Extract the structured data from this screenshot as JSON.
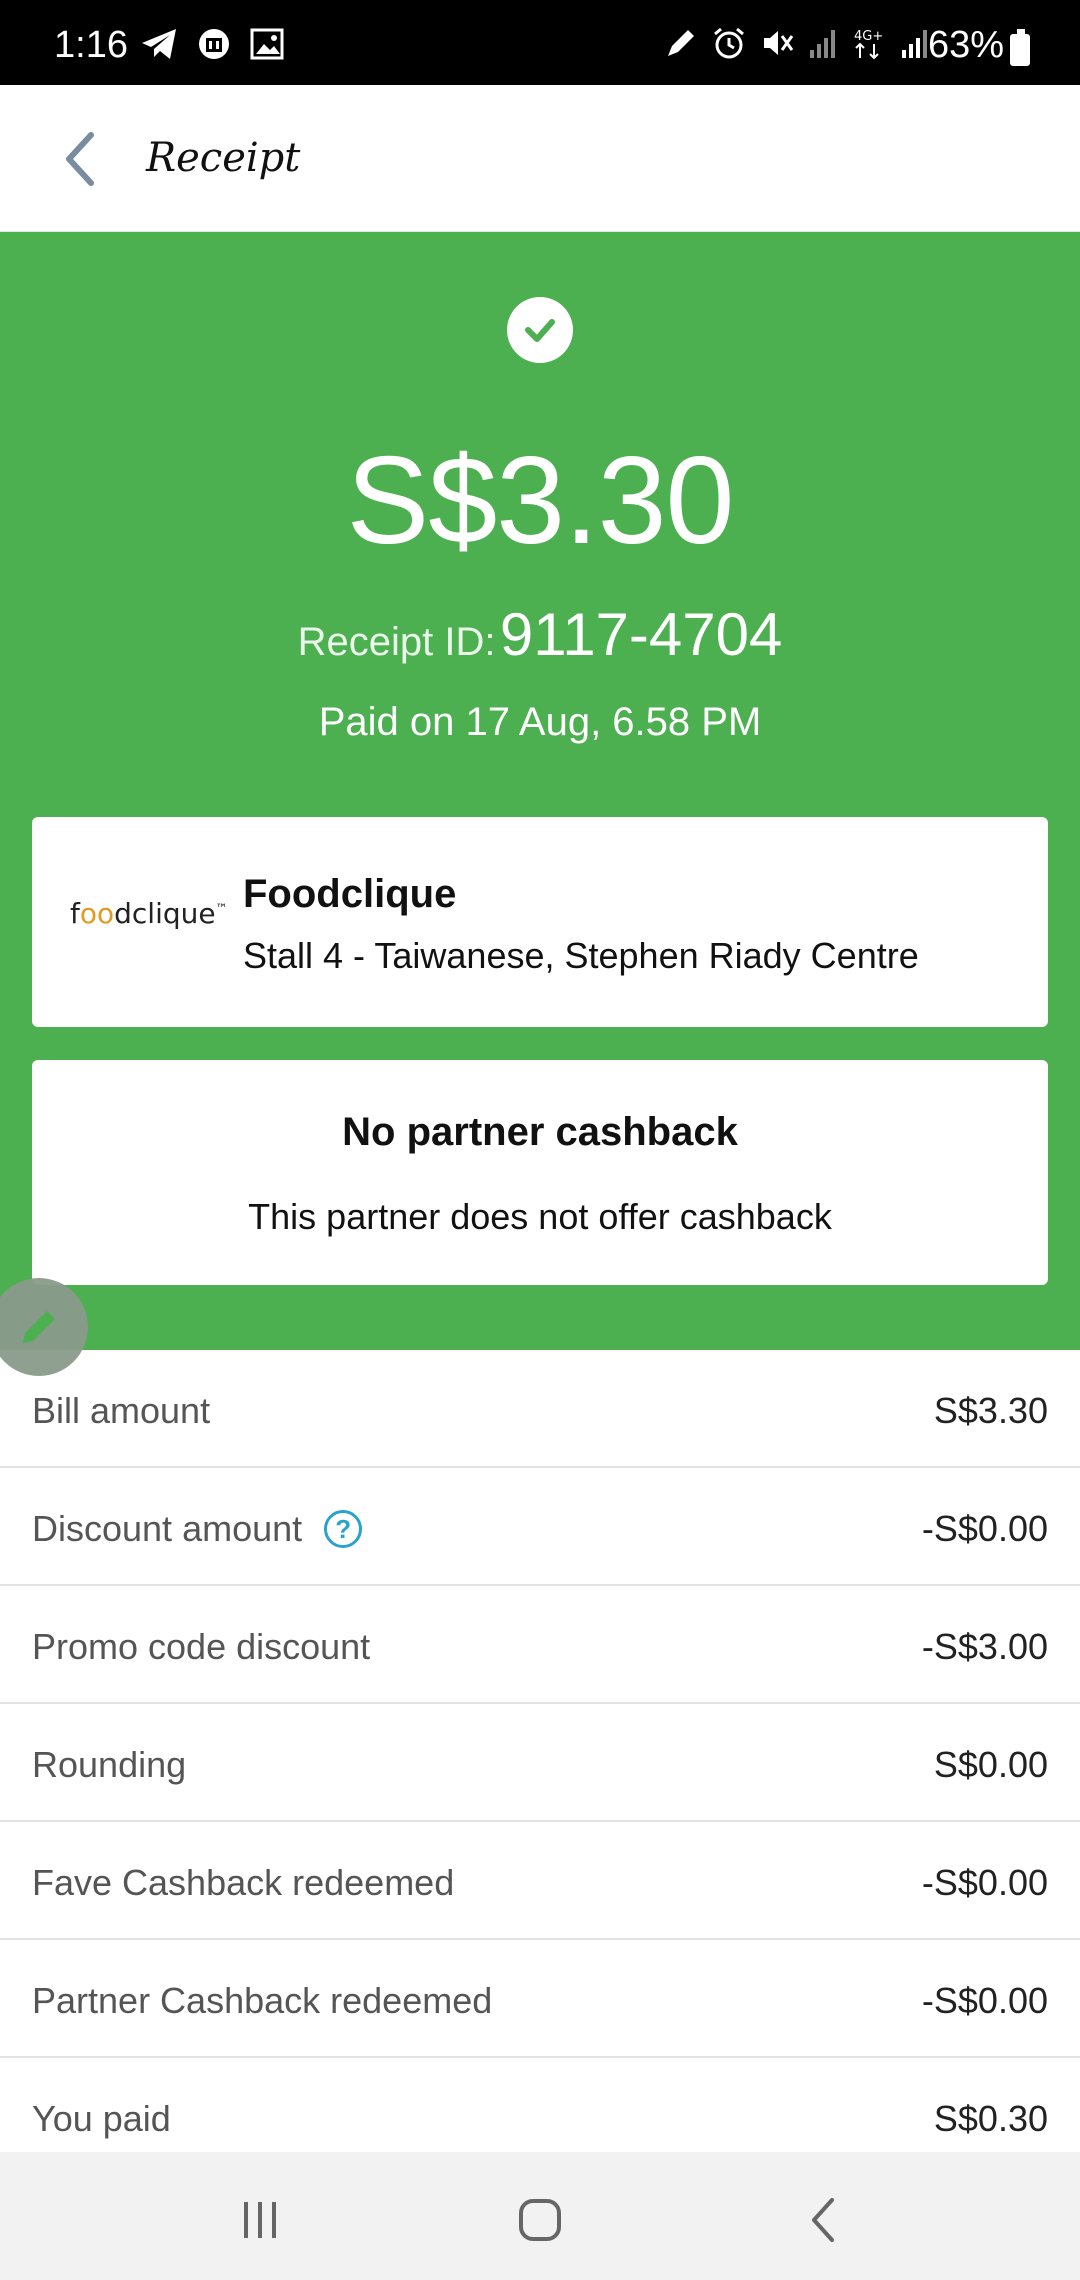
{
  "status_bar": {
    "time": "1:16",
    "battery": "63%",
    "network": "4G+",
    "icons_left": [
      "telegram-icon",
      "app-icon",
      "gallery-icon"
    ],
    "icons_right": [
      "pen-icon",
      "alarm-icon",
      "mute-icon",
      "signal-icon",
      "4g-icon",
      "signal-icon",
      "battery-icon"
    ]
  },
  "app_bar": {
    "title": "Receipt"
  },
  "hero": {
    "amount": "S$3.30",
    "receipt_id_label": "Receipt ID:",
    "receipt_id_value": "9117-4704",
    "paid_on": "Paid on 17 Aug, 6.58 PM",
    "color": "#4caf50"
  },
  "merchant": {
    "logo_text_pre": "f",
    "logo_text_oo": "oo",
    "logo_text_post": "dclique",
    "logo_tm": "™",
    "name": "Foodclique",
    "location": "Stall 4 - Taiwanese, Stephen Riady Centre"
  },
  "cashback": {
    "title": "No partner cashback",
    "subtitle": "This partner does not offer cashback"
  },
  "breakdown": [
    {
      "label": "Bill amount",
      "value": "S$3.30"
    },
    {
      "label": "Discount amount",
      "value": "-S$0.00",
      "help": "?"
    },
    {
      "label": "Promo code discount",
      "value": "-S$3.00"
    },
    {
      "label": "Rounding",
      "value": "S$0.00"
    },
    {
      "label": "Fave Cashback redeemed",
      "value": "-S$0.00"
    },
    {
      "label": "Partner Cashback redeemed",
      "value": "-S$0.00"
    },
    {
      "label": "You paid",
      "value": "S$0.30"
    }
  ]
}
